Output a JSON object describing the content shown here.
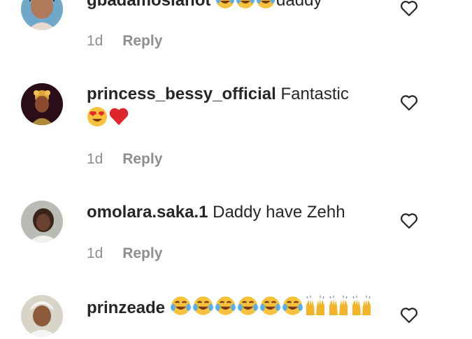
{
  "comments": [
    {
      "username": "gbadamosiahot",
      "text": "daddy",
      "emojis": [
        "laughing-tears-emoji",
        "laughing-tears-emoji",
        "laughing-tears-emoji"
      ],
      "time": "1d",
      "reply_label": "Reply"
    },
    {
      "username": "princess_bessy_official",
      "text": "Fantastic",
      "emojis": [
        "heart-eyes-emoji",
        "red-heart-emoji"
      ],
      "time": "1d",
      "reply_label": "Reply"
    },
    {
      "username": "omolara.saka.1",
      "text": "Daddy have Zehh",
      "emojis": [],
      "time": "1d",
      "reply_label": "Reply"
    },
    {
      "username": "prinzeade",
      "text": "",
      "emojis": [
        "laughing-tears-emoji",
        "laughing-tears-emoji",
        "laughing-tears-emoji",
        "laughing-tears-emoji",
        "laughing-tears-emoji",
        "laughing-tears-emoji",
        "raising-hands-emoji",
        "raising-hands-emoji",
        "raising-hands-emoji"
      ],
      "time": "",
      "reply_label": ""
    }
  ],
  "icons": {
    "like": "heart-outline-icon"
  },
  "colors": {
    "text": "#262626",
    "secondary": "#8e8e8e"
  }
}
